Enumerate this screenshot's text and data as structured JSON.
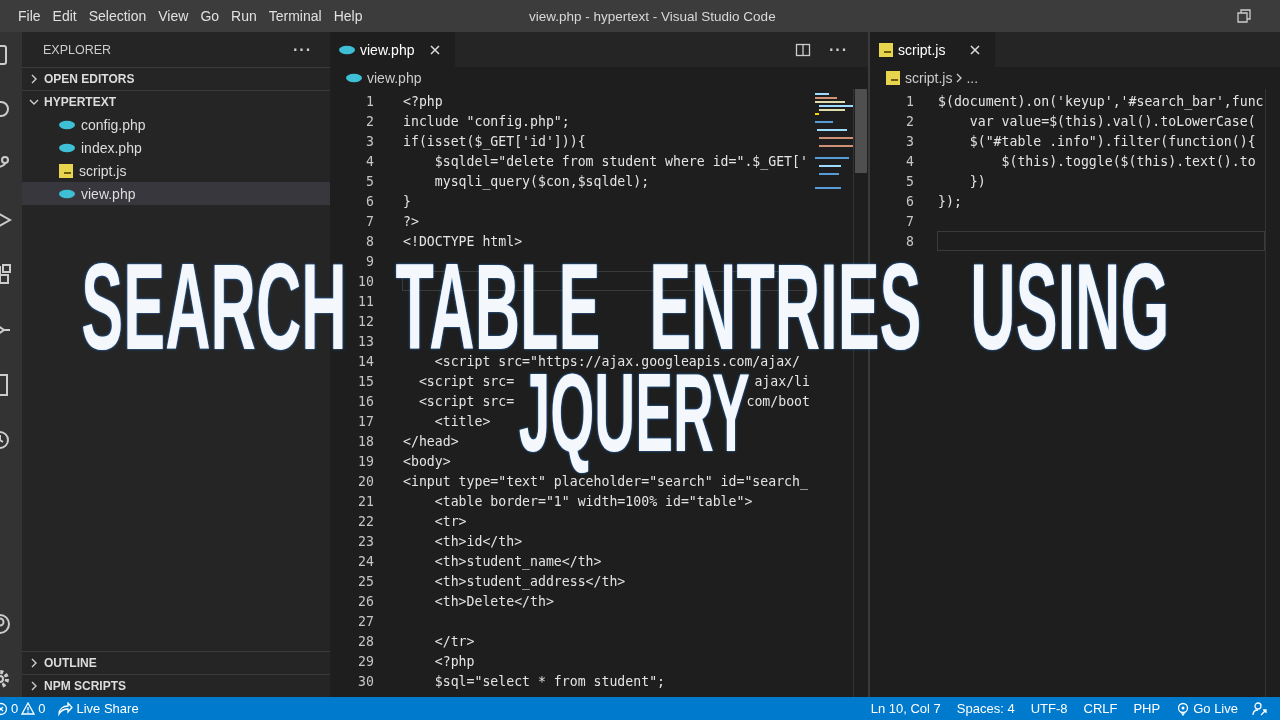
{
  "window": {
    "title": "view.php - hypertext - Visual Studio Code"
  },
  "menu": [
    "File",
    "Edit",
    "Selection",
    "View",
    "Go",
    "Run",
    "Terminal",
    "Help"
  ],
  "sidebar": {
    "title": "EXPLORER",
    "more": "···",
    "sections": [
      {
        "label": "OPEN EDITORS",
        "expanded": false
      },
      {
        "label": "HYPERTEXT",
        "expanded": true,
        "files": [
          {
            "name": "config.php",
            "kind": "php",
            "selected": false
          },
          {
            "name": "index.php",
            "kind": "php",
            "selected": false
          },
          {
            "name": "script.js",
            "kind": "js",
            "selected": false
          },
          {
            "name": "view.php",
            "kind": "php",
            "selected": true
          }
        ]
      }
    ],
    "bottom_sections": [
      {
        "label": "OUTLINE",
        "expanded": false
      },
      {
        "label": "NPM SCRIPTS",
        "expanded": false
      }
    ]
  },
  "editors": [
    {
      "tab": "view.php",
      "kind": "php",
      "actions": true,
      "more": "···",
      "minimap": true,
      "breadcrumb": [
        "view.php"
      ],
      "lines": [
        {
          "n": "1",
          "text": "<?php"
        },
        {
          "n": "2",
          "text": "include \"config.php\";"
        },
        {
          "n": "3",
          "text": "if(isset($_GET['id'])){"
        },
        {
          "n": "4",
          "text": "    $sqldel=\"delete from student where id=\".$_GET['"
        },
        {
          "n": "5",
          "text": "    mysqli_query($con,$sqldel);"
        },
        {
          "n": "6",
          "text": "}"
        },
        {
          "n": "7",
          "text": "?>"
        },
        {
          "n": "8",
          "text": "<!DOCTYPE html>"
        },
        {
          "n": "9"
        },
        {
          "n": "10",
          "current": true
        },
        {
          "n": "11"
        },
        {
          "n": "12"
        },
        {
          "n": "13"
        },
        {
          "n": "14",
          "text": "    <script src=\"https://ajax.googleapis.com/ajax/"
        },
        {
          "n": "15",
          "text": "  <script src=",
          "tail": "ajax/li"
        },
        {
          "n": "16",
          "text": "  <script src=",
          "tail": "com/boot"
        },
        {
          "n": "17",
          "text": "    <title>"
        },
        {
          "n": "18",
          "text": "</head>"
        },
        {
          "n": "19",
          "text": "<body>"
        },
        {
          "n": "20",
          "text": "<input type=\"text\" placeholder=\"search\" id=\"search_"
        },
        {
          "n": "21",
          "text": "    <table border=\"1\" width=100% id=\"table\">"
        },
        {
          "n": "22",
          "text": "    <tr>"
        },
        {
          "n": "23",
          "text": "    <th>id</th>"
        },
        {
          "n": "24",
          "text": "    <th>student_name</th>"
        },
        {
          "n": "25",
          "text": "    <th>student_address</th>"
        },
        {
          "n": "26",
          "text": "    <th>Delete</th>"
        },
        {
          "n": "27"
        },
        {
          "n": "28",
          "text": "    </tr>"
        },
        {
          "n": "29",
          "text": "    <?php"
        },
        {
          "n": "30",
          "text": "    $sql=\"select * from student\";"
        }
      ]
    },
    {
      "tab": "script.js",
      "kind": "js",
      "breadcrumb": [
        "script.js",
        "..."
      ],
      "lines": [
        {
          "n": "1",
          "text": "$(document).on('keyup','#search_bar',func"
        },
        {
          "n": "2",
          "text": "    var value=$(this).val().toLowerCase("
        },
        {
          "n": "3",
          "text": "    $(\"#table .info\").filter(function(){"
        },
        {
          "n": "4",
          "text": "        $(this).toggle($(this).text().to"
        },
        {
          "n": "5",
          "text": "    })"
        },
        {
          "n": "6",
          "text": "});"
        },
        {
          "n": "7"
        },
        {
          "n": "8",
          "current": true
        }
      ]
    }
  ],
  "status_bar": {
    "errors": "0",
    "warnings": "0",
    "live_share": "Live Share",
    "right": [
      "Ln 10, Col 7",
      "Spaces: 4",
      "UTF-8",
      "CRLF",
      "PHP"
    ],
    "go_live": "Go Live"
  },
  "overlay": {
    "lines": [
      {
        "parts": [
          "SEARCH",
          "TABLE ENTRIES USING"
        ]
      },
      {
        "parts": [
          "JQUERY"
        ]
      }
    ]
  }
}
